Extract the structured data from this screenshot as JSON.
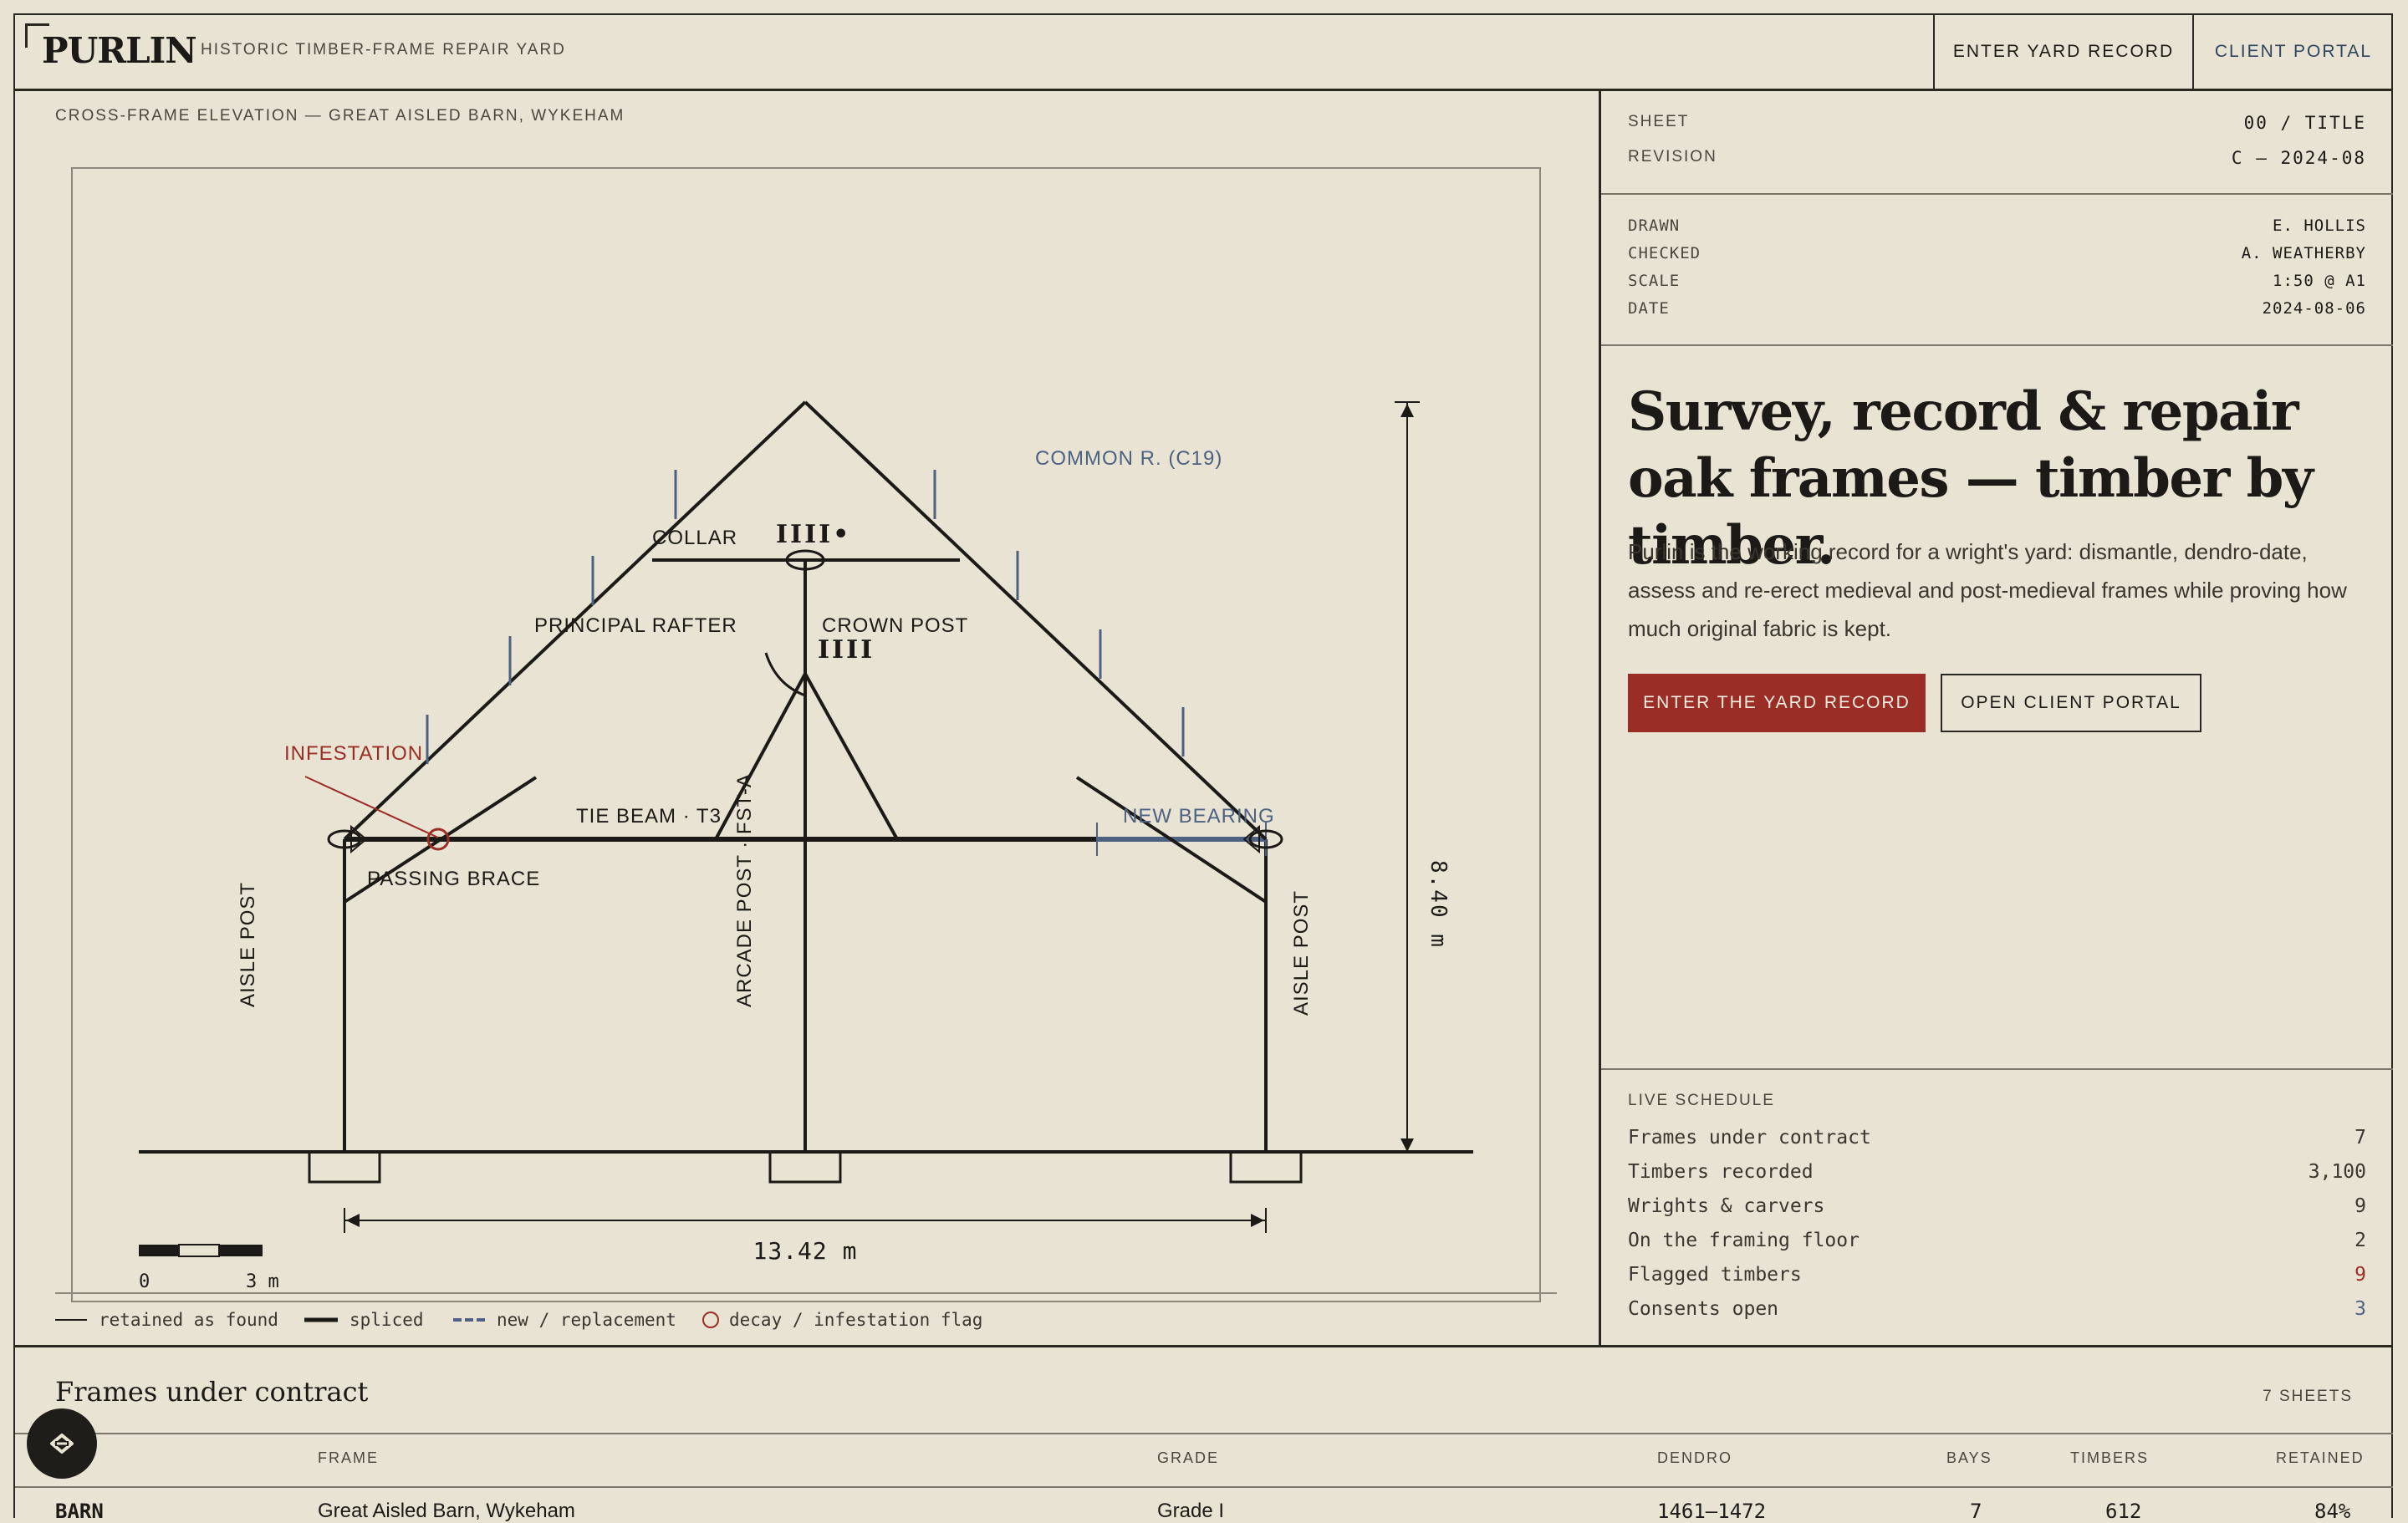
{
  "brand": {
    "logo": "PURLIN",
    "tagline": "HISTORIC TIMBER-FRAME REPAIR YARD"
  },
  "nav": {
    "enter_record": "ENTER YARD RECORD",
    "client_portal": "CLIENT PORTAL"
  },
  "drawing": {
    "title": "CROSS-FRAME ELEVATION — GREAT AISLED BARN, WYKEHAM",
    "labels": {
      "common_rafter": "COMMON R. (C19)",
      "collar": "COLLAR",
      "principal_rafter": "PRINCIPAL RAFTER",
      "crown_post": "CROWN POST",
      "infestation": "INFESTATION",
      "tie_beam": "TIE BEAM · T3",
      "new_bearing": "NEW BEARING",
      "passing_brace": "PASSING BRACE",
      "aisle_post_left": "AISLE POST",
      "aisle_post_right": "AISLE POST",
      "arcade_post": "ARCADE POST · FST-A",
      "carpenter_mark_1": "IIII•",
      "carpenter_mark_2": "IIII"
    },
    "dimensions": {
      "height": "8.40 m",
      "width": "13.42 m"
    },
    "scale_bar": {
      "start": "0",
      "end": "3 m"
    },
    "legend": [
      {
        "key": "retained",
        "label": "retained as found"
      },
      {
        "key": "spliced",
        "label": "spliced"
      },
      {
        "key": "new",
        "label": "new / replacement"
      },
      {
        "key": "decay",
        "label": "decay / infestation flag"
      }
    ]
  },
  "sheet": {
    "sheet_label": "SHEET",
    "sheet_value": "00 / TITLE",
    "revision_label": "REVISION",
    "revision_value": "C — 2024-08",
    "meta": [
      {
        "label": "DRAWN",
        "value": "E. HOLLIS"
      },
      {
        "label": "CHECKED",
        "value": "A. WEATHERBY"
      },
      {
        "label": "SCALE",
        "value": "1:50 @ A1"
      },
      {
        "label": "DATE",
        "value": "2024-08-06"
      }
    ]
  },
  "hero": {
    "headline": "Survey, record & repair oak frames — timber by timber.",
    "lede": "Purlin is the working record for a wright's yard: dismantle, dendro-date, assess and re-erect medieval and post-medieval frames while proving how much original fabric is kept.",
    "cta_primary": "ENTER THE YARD RECORD",
    "cta_secondary": "OPEN CLIENT PORTAL"
  },
  "schedule": {
    "title": "LIVE SCHEDULE",
    "rows": [
      {
        "label": "Frames under contract",
        "value": "7",
        "tone": "normal"
      },
      {
        "label": "Timbers recorded",
        "value": "3,100",
        "tone": "normal"
      },
      {
        "label": "Wrights & carvers",
        "value": "9",
        "tone": "normal"
      },
      {
        "label": "On the framing floor",
        "value": "2",
        "tone": "normal"
      },
      {
        "label": "Flagged timbers",
        "value": "9",
        "tone": "alert"
      },
      {
        "label": "Consents open",
        "value": "3",
        "tone": "info"
      }
    ]
  },
  "table": {
    "title": "Frames under contract",
    "count": "7 SHEETS",
    "columns": [
      "FRAME",
      "GRADE",
      "DENDRO",
      "BAYS",
      "TIMBERS",
      "RETAINED"
    ],
    "first_row": {
      "id": "BARN",
      "frame": "Great Aisled Barn, Wykeham",
      "grade": "Grade I",
      "dendro": "1461–1472",
      "bays": "7",
      "timbers": "612",
      "retained": "84%"
    }
  },
  "colors": {
    "paper": "#e9e3d3",
    "ink": "#1c1a16",
    "accent_red": "#9b2d27",
    "accent_blue": "#4d6282"
  }
}
